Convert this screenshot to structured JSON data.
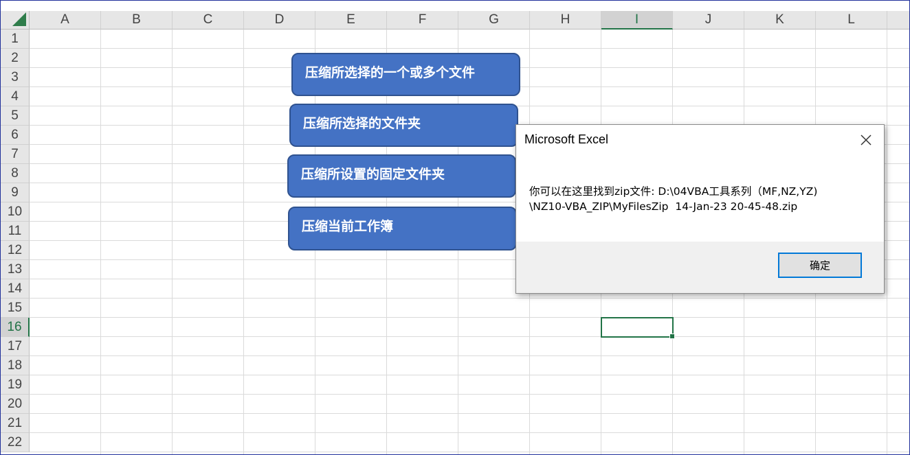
{
  "sheet": {
    "columns": [
      "A",
      "B",
      "C",
      "D",
      "E",
      "F",
      "G",
      "H",
      "I",
      "J",
      "K",
      "L"
    ],
    "rows": [
      "1",
      "2",
      "3",
      "4",
      "5",
      "6",
      "7",
      "8",
      "9",
      "10",
      "11",
      "12",
      "13",
      "14",
      "15",
      "16",
      "17",
      "18",
      "19",
      "20",
      "21",
      "22"
    ],
    "selected_column": "I",
    "selected_row": "16"
  },
  "buttons": {
    "zip_selected_files": "压缩所选择的一个或多个文件",
    "zip_selected_folder": "压缩所选择的文件夹",
    "zip_fixed_folder": "压缩所设置的固定文件夹",
    "zip_current_workbook": "压缩当前工作簿"
  },
  "dialog": {
    "title": "Microsoft Excel",
    "close_icon": "close-icon",
    "message_line1": "你可以在这里找到zip文件: D:\\04VBA工具系列（MF,NZ,YZ)",
    "message_line2": "\\NZ10-VBA_ZIP\\MyFilesZip  14-Jan-23 20-45-48.zip",
    "ok_label": "确定"
  },
  "colors": {
    "accent_green": "#217346",
    "shape_fill": "#4472c4",
    "shape_border": "#2f528f"
  }
}
